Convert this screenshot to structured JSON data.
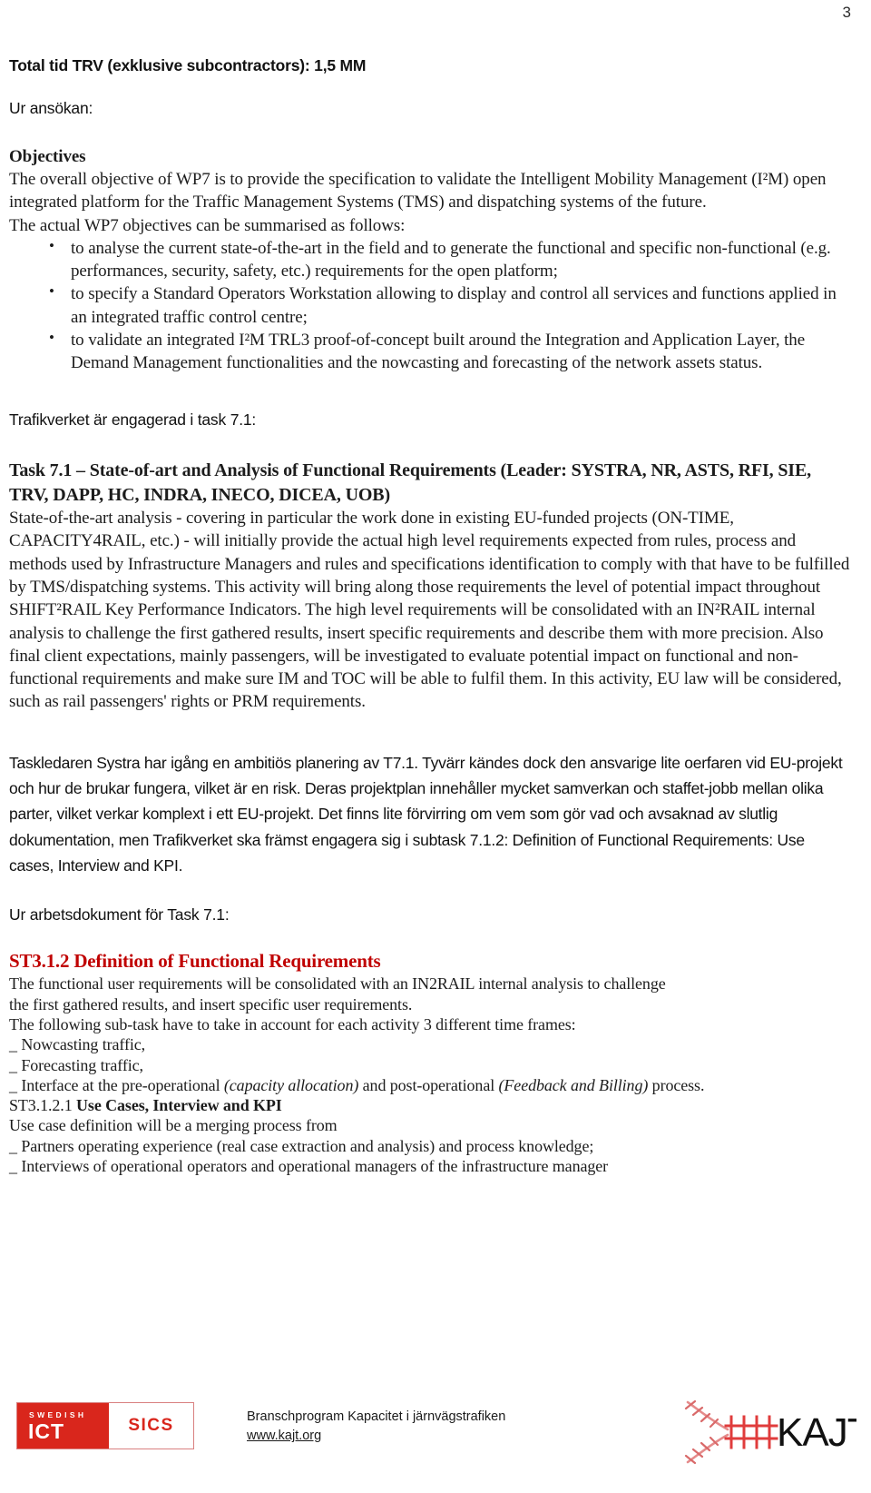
{
  "page": {
    "number": "3"
  },
  "doc": {
    "total_time_line": "Total tid TRV (exklusive subcontractors): 1,5 MM",
    "from_application_label": "Ur ansökan:",
    "objectives_heading": "Objectives",
    "objectives_intro": "The overall objective of WP7 is to provide the specification to validate the Intelligent Mobility Management (I²M) open integrated platform for the Traffic Management Systems (TMS) and dispatching systems of the future.",
    "objectives_summary_line": "The actual WP7 objectives can be summarised as follows:",
    "objectives_bullets": [
      "to analyse the current state-of-the-art in the field and to generate the functional and specific non-functional (e.g. performances, security, safety, etc.) requirements for the open platform;",
      "to specify a Standard Operators Workstation allowing to display and control all services and functions applied in an integrated traffic control centre;",
      "to validate an integrated I²M TRL3 proof-of-concept built around the Integration and Application Layer, the Demand Management functionalities and the nowcasting and forecasting of the network assets status."
    ],
    "trafikverket_line": "Trafikverket är engagerad i task 7.1:",
    "task_heading": "Task 7.1 – State-of-art and Analysis of Functional Requirements (Leader: SYSTRA, NR, ASTS, RFI, SIE, TRV, DAPP, HC, INDRA, INECO, DICEA, UOB)",
    "task_body": "State-of-the-art analysis - covering in particular the work done in existing EU-funded projects (ON-TIME, CAPACITY4RAIL, etc.) - will initially provide the actual high level requirements expected from rules, process and methods used by Infrastructure Managers and rules and specifications identification to comply with that have to be fulfilled by TMS/dispatching systems. This activity will bring along those requirements the level of potential impact throughout SHIFT²RAIL Key Performance Indicators. The high level requirements will be consolidated with an IN²RAIL internal analysis to challenge the first gathered results, insert specific requirements and describe them with more precision. Also final client expectations, mainly passengers, will be investigated to evaluate potential impact on functional and non-functional requirements and make sure IM and TOC will be able to fulfil them. In this activity, EU law will be considered, such as rail passengers' rights or PRM requirements.",
    "commentary_paragraph": "Taskledaren Systra har igång en ambitiös planering av T7.1. Tyvärr kändes dock den ansvarige lite oerfaren vid EU-projekt och hur de brukar fungera, vilket är en risk. Deras projektplan innehåller mycket samverkan och staffet-jobb mellan olika parter, vilket verkar komplext i ett EU-projekt. Det finns lite förvirring om vem som gör vad och avsaknad av slutlig dokumentation, men Trafikverket ska främst engagera sig i subtask 7.1.2: Definition of Functional Requirements: Use cases, Interview and KPI.",
    "work_document_label": "Ur arbetsdokument för Task 7.1:",
    "st_heading": "ST3.1.2 Definition of Functional Requirements",
    "st_lines": [
      "The functional user requirements will be consolidated with an IN2RAIL internal analysis to challenge",
      "the first gathered results, and insert specific user requirements.",
      "The following sub-task have to take in account for each activity 3 different time frames:"
    ],
    "st_dash_items": [
      "Nowcasting traffic,",
      "Forecasting traffic,"
    ],
    "st_interface_line_pre": "Interface at the pre-operational ",
    "st_interface_italic_1": "(capacity allocation)",
    "st_interface_mid": " and post-operational ",
    "st_interface_italic_2": "(Feedback and Billing)",
    "st_interface_post": " process.",
    "st_sub_prefix": "ST3.1.2.1 ",
    "st_sub_bold": "Use Cases, Interview and KPI",
    "st_usecase_line": "Use case definition will be a merging process from",
    "st_usecase_dash_items": [
      "Partners operating experience (real case extraction and analysis) and process knowledge;",
      "Interviews of operational operators and operational managers of the infrastructure manager"
    ]
  },
  "footer": {
    "sics_swedish": "SWEDISH",
    "sics_ict": "ICT",
    "sics_word": "SICS",
    "program_name": "Branschprogram Kapacitet i järnvägstrafiken",
    "url": "www.kajt.org",
    "kajt_word": "KAJT"
  },
  "colors": {
    "heading_red": "#c00000",
    "logo_red": "#d9261c",
    "kajt_track_red": "#e06666"
  }
}
